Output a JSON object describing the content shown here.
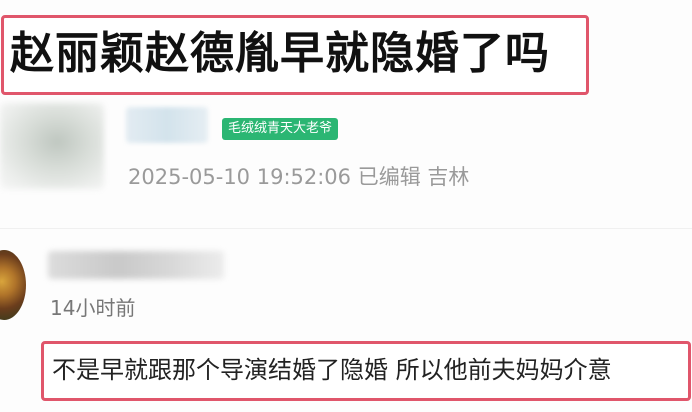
{
  "post": {
    "title": "赵丽颖赵德胤早就隐婚了吗",
    "author_tag": "毛绒绒青天大老爷",
    "meta": "2025-05-10 19:52:06 已编辑 吉林"
  },
  "comment": {
    "time": "14小时前",
    "text": "不是早就跟那个导演结婚了隐婚 所以他前夫妈妈介意"
  },
  "colors": {
    "highlight_border": "#e0566b",
    "tag_green": "#2bb673"
  }
}
